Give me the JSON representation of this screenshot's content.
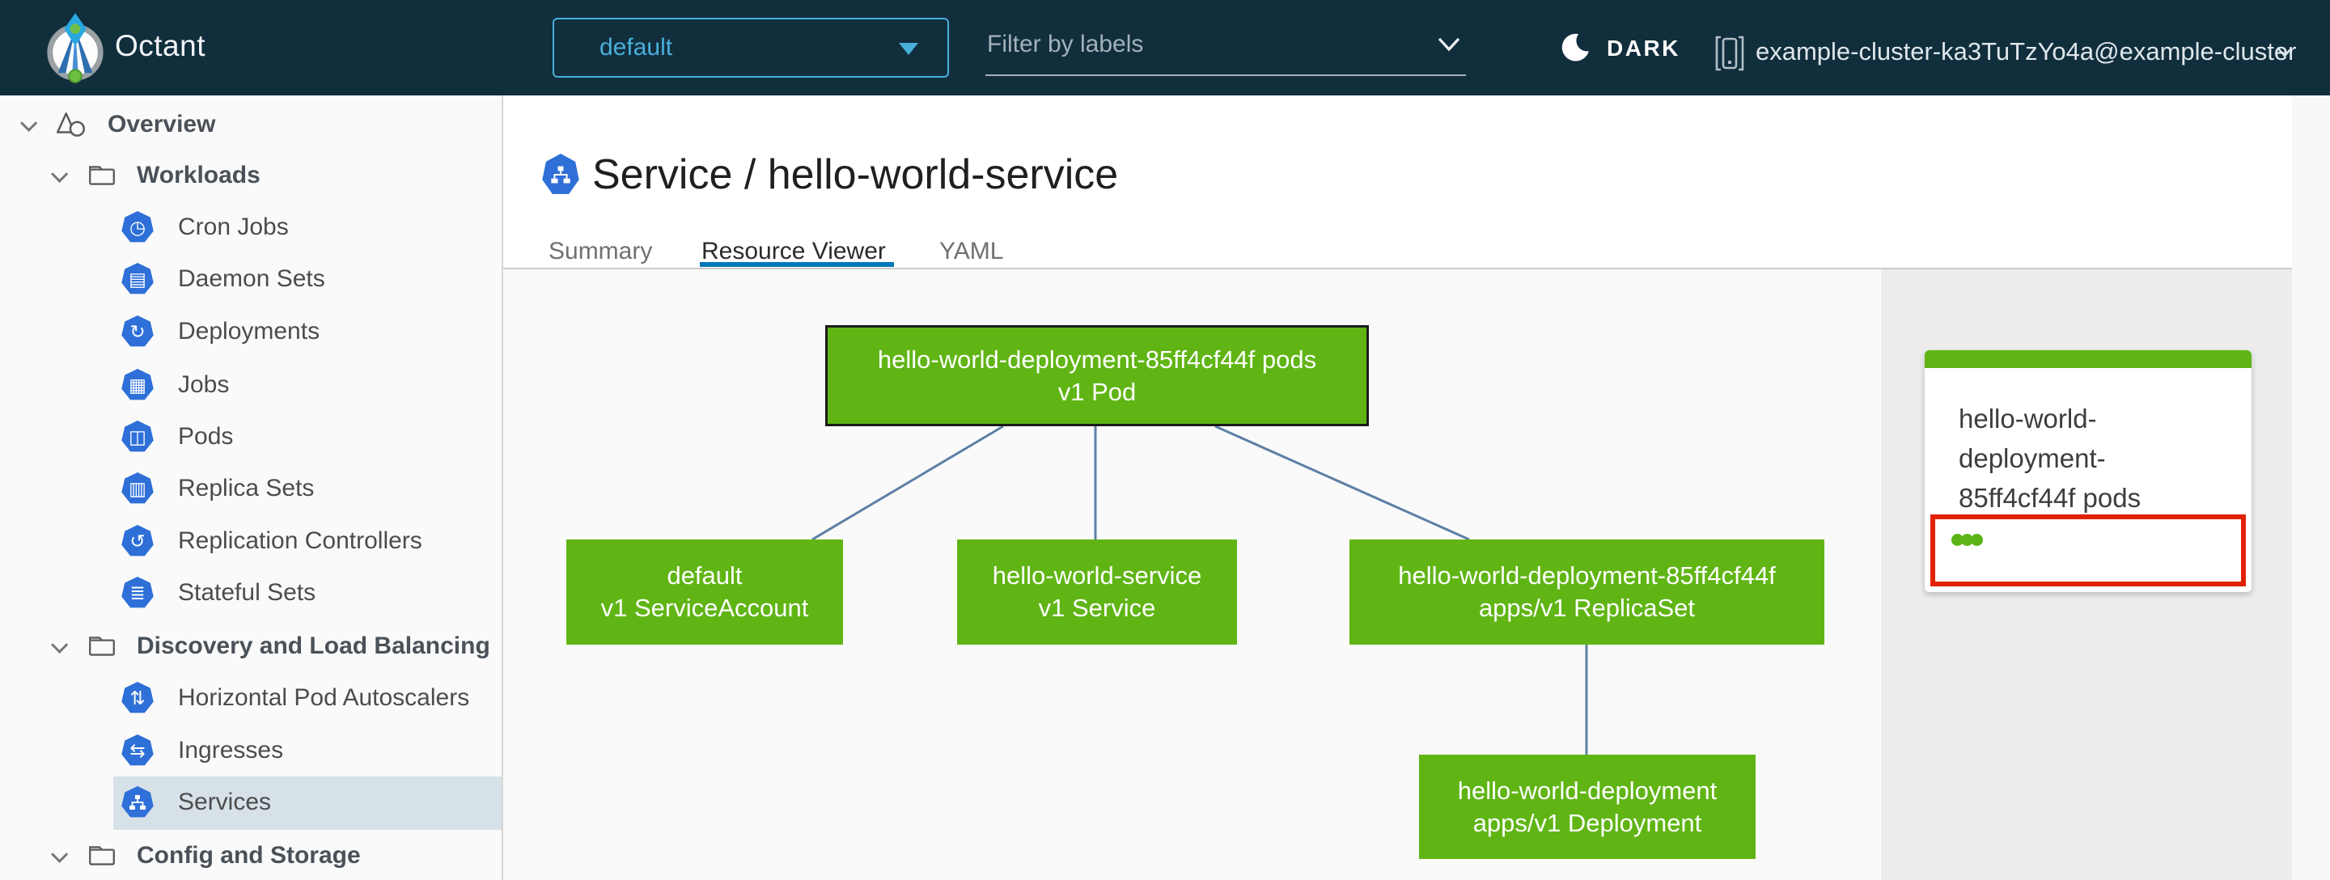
{
  "header": {
    "app_title": "Octant",
    "namespace_dropdown": {
      "value": "default"
    },
    "filter_input": {
      "placeholder": "Filter by labels"
    },
    "theme_toggle": {
      "label": "DARK"
    },
    "cluster_selector": {
      "label": "example-cluster-ka3TuTzYo4a@example-cluster"
    }
  },
  "sidebar": {
    "items": [
      {
        "label": "Overview",
        "icon": "overview-icon",
        "level": 0
      },
      {
        "label": "Workloads",
        "icon": "folder-icon",
        "level": 1
      },
      {
        "label": "Cron Jobs",
        "icon": "cron-jobs-icon",
        "glyph": "◷",
        "level": 2
      },
      {
        "label": "Daemon Sets",
        "icon": "daemon-sets-icon",
        "glyph": "▤",
        "level": 2
      },
      {
        "label": "Deployments",
        "icon": "deployments-icon",
        "glyph": "↻",
        "level": 2
      },
      {
        "label": "Jobs",
        "icon": "jobs-icon",
        "glyph": "▦",
        "level": 2
      },
      {
        "label": "Pods",
        "icon": "pods-icon",
        "glyph": "◫",
        "level": 2
      },
      {
        "label": "Replica Sets",
        "icon": "replica-sets-icon",
        "glyph": "▥",
        "level": 2
      },
      {
        "label": "Replication Controllers",
        "icon": "replication-controllers-icon",
        "glyph": "↺",
        "level": 2
      },
      {
        "label": "Stateful Sets",
        "icon": "stateful-sets-icon",
        "glyph": "≣",
        "level": 2
      },
      {
        "label": "Discovery and Load Balancing",
        "icon": "folder-icon",
        "level": 1
      },
      {
        "label": "Horizontal Pod Autoscalers",
        "icon": "hpa-icon",
        "glyph": "⇅",
        "level": 2
      },
      {
        "label": "Ingresses",
        "icon": "ingresses-icon",
        "glyph": "⇆",
        "level": 2
      },
      {
        "label": "Services",
        "icon": "services-icon",
        "level": 2,
        "selected": true
      },
      {
        "label": "Config and Storage",
        "icon": "folder-icon",
        "level": 1
      }
    ]
  },
  "main": {
    "page_title": "Service / hello-world-service",
    "tabs": [
      {
        "label": "Summary",
        "active": false
      },
      {
        "label": "Resource Viewer",
        "active": true
      },
      {
        "label": "YAML",
        "active": false
      }
    ]
  },
  "graph": {
    "nodes": [
      {
        "id": "pod",
        "name": "hello-world-deployment-85ff4cf44f pods",
        "kind": "v1 Pod",
        "selected": true,
        "status": "ok"
      },
      {
        "id": "serviceaccount",
        "name": "default",
        "kind": "v1 ServiceAccount",
        "status": "ok"
      },
      {
        "id": "service",
        "name": "hello-world-service",
        "kind": "v1 Service",
        "status": "ok"
      },
      {
        "id": "replicaset",
        "name": "hello-world-deployment-85ff4cf44f",
        "kind": "apps/v1 ReplicaSet",
        "status": "ok"
      },
      {
        "id": "deployment",
        "name": "hello-world-deployment",
        "kind": "apps/v1 Deployment",
        "status": "ok"
      }
    ]
  },
  "detail_panel": {
    "card_title": "hello-world-deployment-85ff4cf44f pods",
    "pod_status_dot_count": 3
  },
  "colors": {
    "header_bg": "#112e3d",
    "accent_blue": "#49afd9",
    "tab_active_blue": "#0079b8",
    "node_green": "#60b515",
    "alert_red": "#e12200",
    "edge_blue": "#5c80a5",
    "k8s_icon_blue": "#2e6fd8",
    "selected_row_bg": "#d7e1e8"
  }
}
